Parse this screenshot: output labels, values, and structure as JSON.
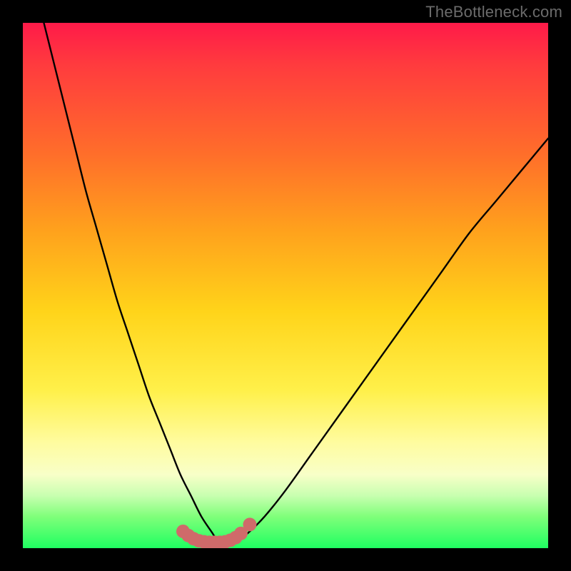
{
  "watermark": "TheBottleneck.com",
  "chart_data": {
    "type": "line",
    "title": "",
    "xlabel": "",
    "ylabel": "",
    "xlim": [
      0,
      100
    ],
    "ylim": [
      0,
      100
    ],
    "grid": false,
    "series": [
      {
        "name": "bottleneck-curve",
        "x": [
          4,
          6,
          8,
          10,
          12,
          14,
          16,
          18,
          20,
          22,
          24,
          26,
          28,
          30,
          32,
          34,
          36,
          37,
          38,
          39,
          41,
          43,
          46,
          50,
          55,
          60,
          65,
          70,
          75,
          80,
          85,
          90,
          95,
          100
        ],
        "y": [
          100,
          92,
          84,
          76,
          68,
          61,
          54,
          47,
          41,
          35,
          29,
          24,
          19,
          14,
          10,
          6,
          3,
          1.5,
          1,
          1,
          1.5,
          3,
          6,
          11,
          18,
          25,
          32,
          39,
          46,
          53,
          60,
          66,
          72,
          78
        ]
      }
    ],
    "markers": [
      {
        "name": "marker-dot",
        "x": 30.5,
        "y": 3.2
      },
      {
        "name": "marker-dot",
        "x": 31.5,
        "y": 2.4
      },
      {
        "name": "marker-dot",
        "x": 32.5,
        "y": 1.8
      },
      {
        "name": "marker-dot",
        "x": 33.5,
        "y": 1.4
      },
      {
        "name": "marker-dot",
        "x": 34.5,
        "y": 1.2
      },
      {
        "name": "marker-dot",
        "x": 35.5,
        "y": 1.1
      },
      {
        "name": "marker-dot",
        "x": 36.5,
        "y": 1.1
      },
      {
        "name": "marker-dot",
        "x": 37.5,
        "y": 1.1
      },
      {
        "name": "marker-dot",
        "x": 38.5,
        "y": 1.2
      },
      {
        "name": "marker-dot",
        "x": 39.5,
        "y": 1.5
      },
      {
        "name": "marker-dot",
        "x": 40.5,
        "y": 2.0
      },
      {
        "name": "marker-dot",
        "x": 41.5,
        "y": 2.8
      },
      {
        "name": "marker-dot",
        "x": 43.2,
        "y": 4.5
      }
    ],
    "colors": {
      "curve": "#000000",
      "marker": "#cf6a6a",
      "gradient_top": "#ff1a49",
      "gradient_bottom": "#1fff61"
    }
  }
}
